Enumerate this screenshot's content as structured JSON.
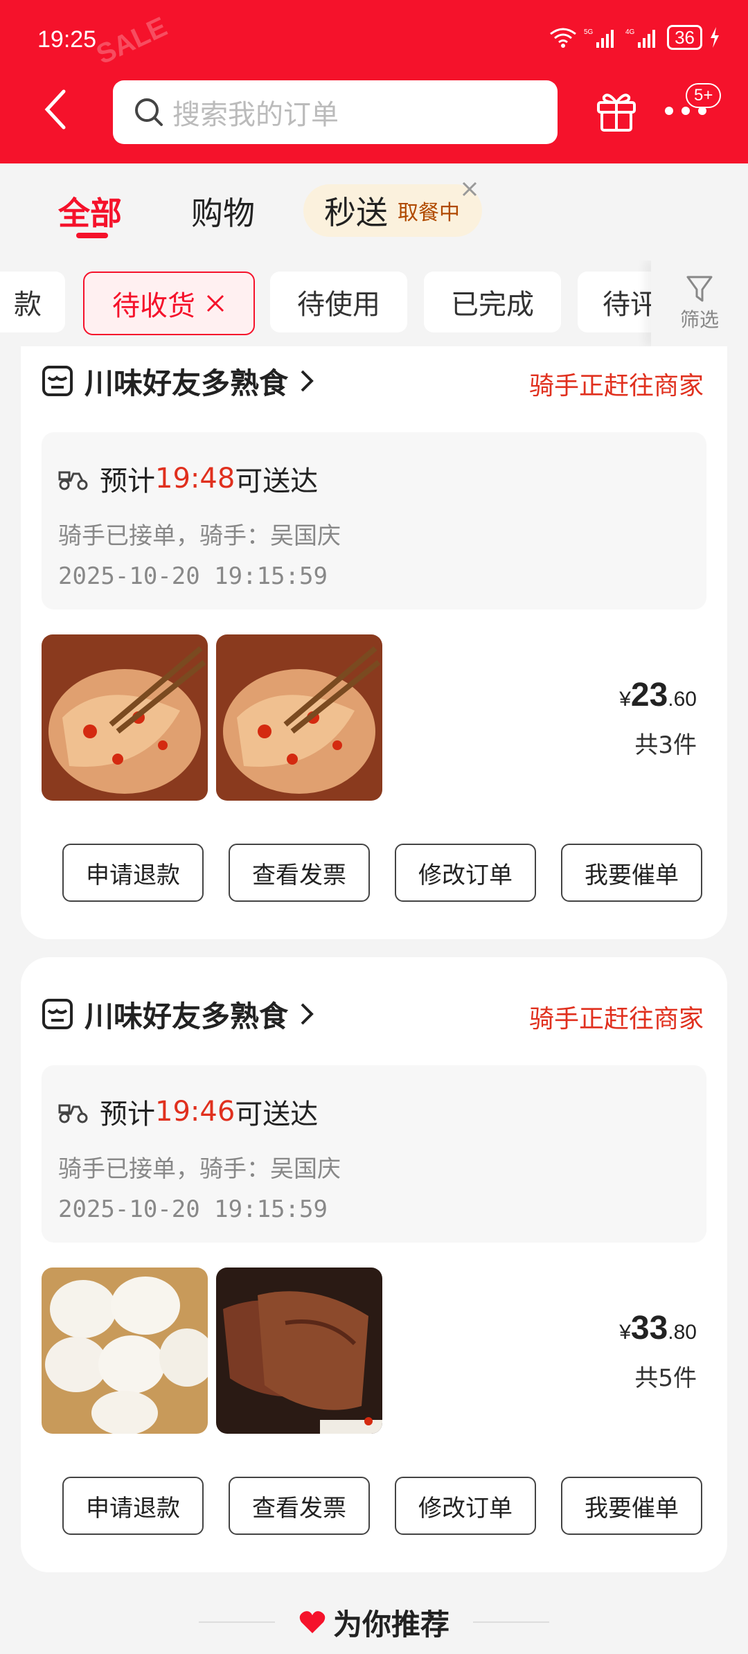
{
  "status_bar": {
    "time": "19:25",
    "battery": "36"
  },
  "search": {
    "placeholder": "搜索我的订单"
  },
  "header": {
    "badge": "5+"
  },
  "tabs": [
    {
      "label": "全部"
    },
    {
      "label": "购物"
    },
    {
      "label": "秒送",
      "sub": "取餐中"
    }
  ],
  "filters": [
    {
      "label": "款"
    },
    {
      "label": "待收货"
    },
    {
      "label": "待使用"
    },
    {
      "label": "已完成"
    },
    {
      "label": "待评"
    }
  ],
  "filter_button": {
    "label": "筛选"
  },
  "orders": [
    {
      "store": "川味好友多熟食",
      "status": "骑手正赶往商家",
      "eta_prefix": "预计",
      "eta_time": "19:48",
      "eta_suffix": "可送达",
      "rider": "骑手已接单，骑手：吴国庆",
      "timestamp": "2025-10-20 19:15:59",
      "price_yen": "¥",
      "price_int": "23",
      "price_dec": ".60",
      "count": "共3件",
      "buttons": [
        "申请退款",
        "查看发票",
        "修改订单",
        "我要催单"
      ]
    },
    {
      "store": "川味好友多熟食",
      "status": "骑手正赶往商家",
      "eta_prefix": "预计",
      "eta_time": "19:46",
      "eta_suffix": "可送达",
      "rider": "骑手已接单，骑手：吴国庆",
      "timestamp": "2025-10-20 19:15:59",
      "price_yen": "¥",
      "price_int": "33",
      "price_dec": ".80",
      "count": "共5件",
      "buttons": [
        "申请退款",
        "查看发票",
        "修改订单",
        "我要催单"
      ]
    }
  ],
  "recommend": {
    "label": "为你推荐"
  },
  "colors": {
    "brand_red": "#f5122b",
    "status_red": "#e0301e"
  }
}
